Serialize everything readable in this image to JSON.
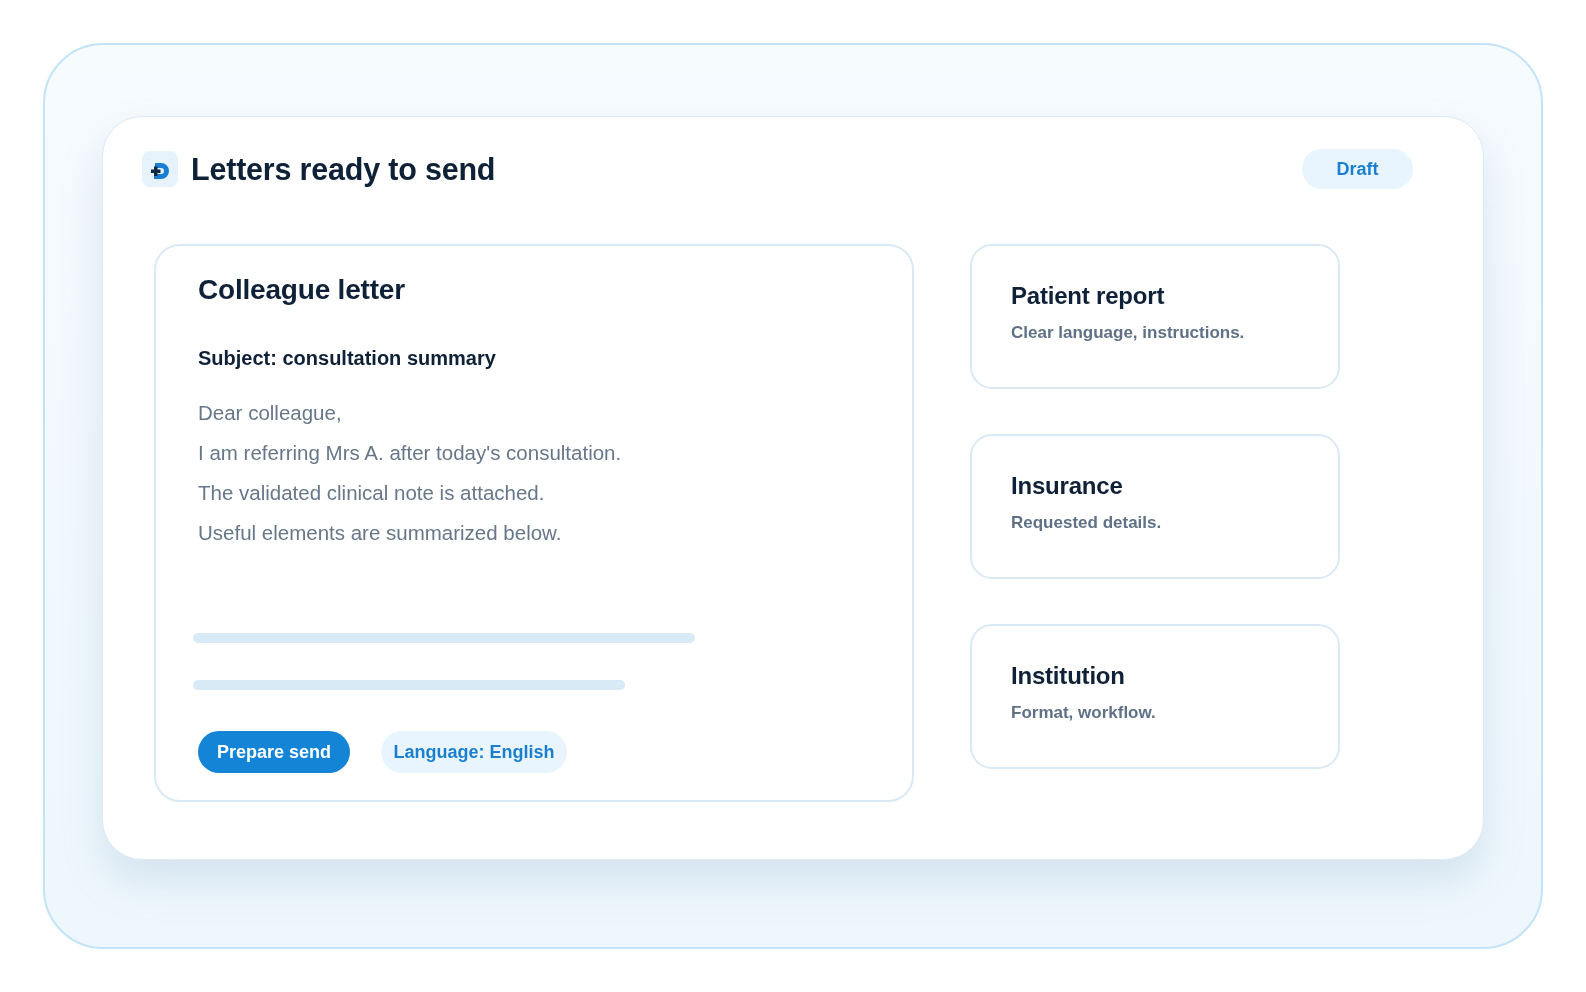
{
  "header": {
    "title": "Letters ready to send",
    "badge": "Draft"
  },
  "letter": {
    "title": "Colleague letter",
    "subject": "Subject: consultation summary",
    "body": [
      "Dear colleague,",
      "I am referring Mrs A. after today's consultation.",
      "The validated clinical note is attached.",
      "Useful elements are summarized below."
    ],
    "actions": [
      {
        "label": "Prepare send",
        "kind": "primary"
      },
      {
        "label": "Language: English",
        "kind": "secondary"
      }
    ]
  },
  "letter_types": [
    {
      "title": "Patient report",
      "description": "Clear language, instructions."
    },
    {
      "title": "Insurance",
      "description": "Requested details."
    },
    {
      "title": "Institution",
      "description": "Format, workflow."
    }
  ]
}
